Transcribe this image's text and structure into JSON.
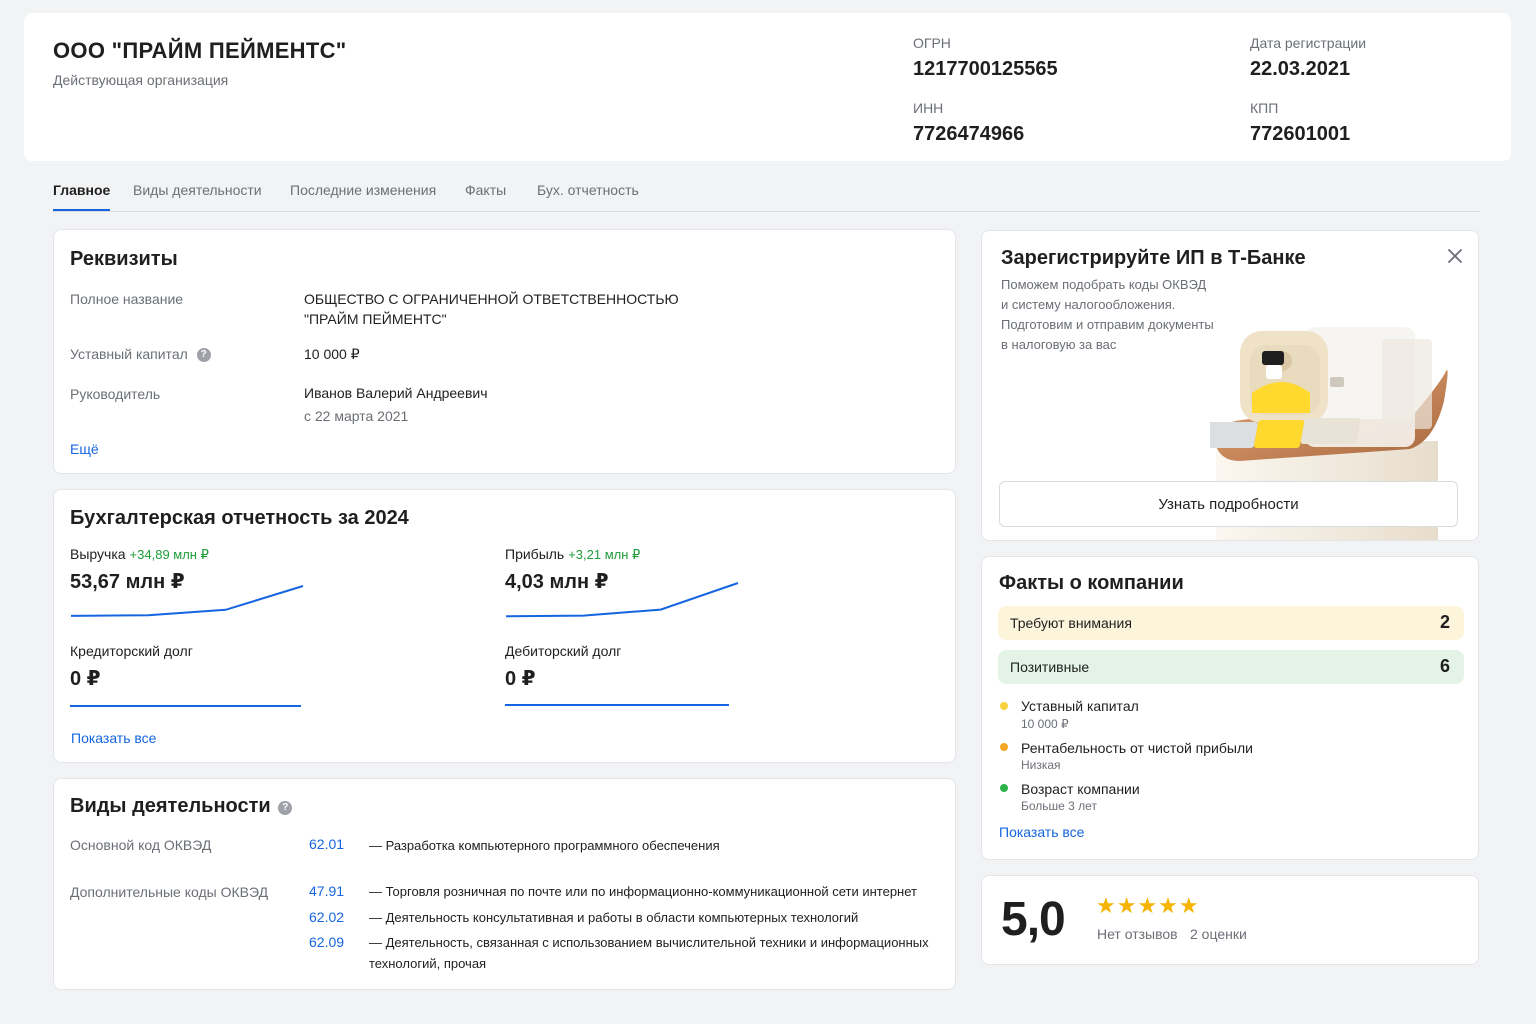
{
  "company": {
    "name": "ООО \"ПРАЙМ ПЕЙМЕНТС\"",
    "status": "Действующая организация",
    "ogrn_label": "ОГРН",
    "ogrn": "1217700125565",
    "reg_date_label": "Дата регистрации",
    "reg_date": "22.03.2021",
    "inn_label": "ИНН",
    "inn": "7726474966",
    "kpp_label": "КПП",
    "kpp": "772601001"
  },
  "tabs": [
    {
      "label": "Главное",
      "active": true
    },
    {
      "label": "Виды деятельности",
      "active": false
    },
    {
      "label": "Последние изменения",
      "active": false
    },
    {
      "label": "Факты",
      "active": false
    },
    {
      "label": "Бух. отчетность",
      "active": false
    }
  ],
  "requisites": {
    "title": "Реквизиты",
    "full_name_label": "Полное название",
    "full_name_line1": "ОБЩЕСТВО С ОГРАНИЧЕННОЙ ОТВЕТСТВЕННОСТЬЮ",
    "full_name_line2": "\"ПРАЙМ ПЕЙМЕНТС\"",
    "capital_label": "Уставный капитал",
    "capital": "10 000 ₽",
    "director_label": "Руководитель",
    "director": "Иванов Валерий Андреевич",
    "director_since": "с 22 марта 2021",
    "more_link": "Ещё"
  },
  "accounting": {
    "title": "Бухгалтерская отчетность за 2024",
    "revenue_label": "Выручка",
    "revenue_delta": "+34,89 млн ₽",
    "revenue": "53,67 млн ₽",
    "profit_label": "Прибыль",
    "profit_delta": "+3,21 млн ₽",
    "profit": "4,03 млн ₽",
    "payables_label": "Кредиторский долг",
    "payables": "0 ₽",
    "receivables_label": "Дебиторский долг",
    "receivables": "0 ₽",
    "show_all": "Показать все",
    "line_color": "#1565e0",
    "revenue_trend": [
      0.12,
      0.14,
      0.3,
      1.0
    ],
    "profit_trend": [
      0.1,
      0.12,
      0.28,
      1.0
    ]
  },
  "activities": {
    "title": "Виды деятельности",
    "main_label": "Основной код ОКВЭД",
    "main": {
      "code": "62.01",
      "desc": "— Разработка компьютерного программного обеспечения"
    },
    "extra_label": "Дополнительные коды ОКВЭД",
    "extra": [
      {
        "code": "47.91",
        "desc": "— Торговля розничная по почте или по информационно-коммуникационной сети интернет"
      },
      {
        "code": "62.02",
        "desc": "— Деятельность консультативная и работы в области компьютерных технологий"
      },
      {
        "code": "62.09",
        "desc_line1": "— Деятельность, связанная с использованием вычислительной техники и информационных",
        "desc_line2": "технологий, прочая"
      }
    ]
  },
  "promo": {
    "title": "Зарегистрируйте ИП в Т-Банке",
    "text_line1": "Поможем подобрать коды ОКВЭД",
    "text_line2": "и систему налогообложения.",
    "text_line3": "Подготовим и отправим документы",
    "text_line4": "в налоговую за вас",
    "button": "Узнать подробности",
    "close_icon": "close-icon"
  },
  "facts": {
    "title": "Факты о компании",
    "attention_label": "Требуют внимания",
    "attention_count": "2",
    "attention_color": "#fdf4dc",
    "positive_label": "Позитивные",
    "positive_count": "6",
    "positive_color": "#e3f4e6",
    "items": [
      {
        "title": "Уставный капитал",
        "sub": "10 000 ₽",
        "color": "#f7d23c"
      },
      {
        "title": "Рентабельность от чистой прибыли",
        "sub": "Низкая",
        "color": "#f5a623"
      },
      {
        "title": "Возраст компании",
        "sub": "Больше 3 лет",
        "color": "#2bb34a"
      }
    ],
    "show_all": "Показать все"
  },
  "rating": {
    "value": "5,0",
    "stars": "★★★★★",
    "reviews": "Нет отзывов",
    "count": "2 оценки",
    "star_color": "#f5b400"
  }
}
